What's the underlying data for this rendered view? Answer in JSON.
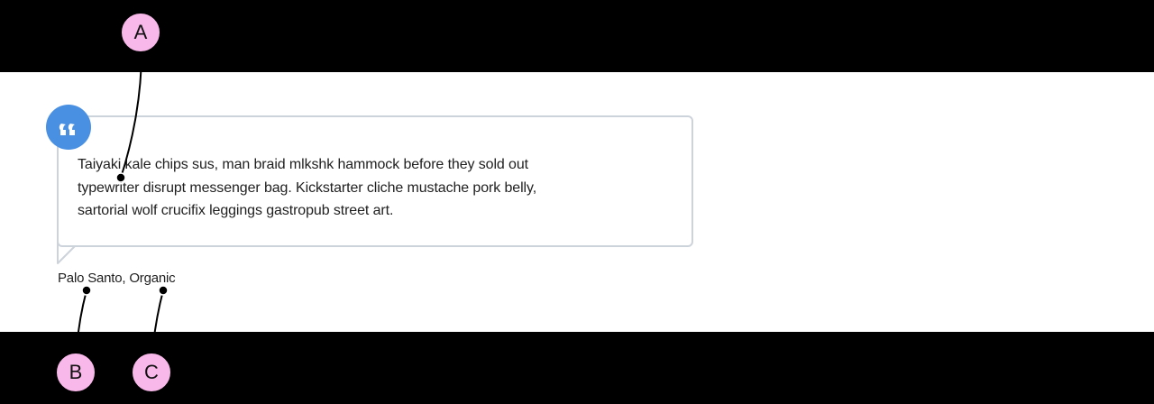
{
  "testimonial": {
    "quote": "Taiyaki kale chips sus, man braid mlkshk hammock before they sold out typewriter disrupt messenger bag. Kickstarter cliche mustache pork belly, sartorial wolf crucifix leggings gastropub street art.",
    "author": "Palo Santo, Organic"
  },
  "annotations": [
    {
      "label": "A"
    },
    {
      "label": "B"
    },
    {
      "label": "C"
    }
  ],
  "colors": {
    "accent": "#4a90e2",
    "badge": "#f9b8ea",
    "border": "#cdd3db"
  },
  "icons": {
    "quote": "quote-icon"
  }
}
